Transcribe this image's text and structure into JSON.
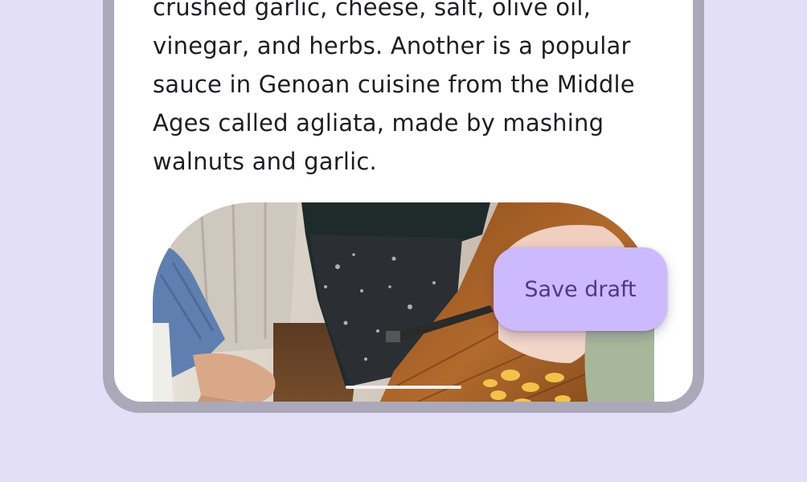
{
  "article": {
    "text_lines": [
      "crushed garlic, cheese, salt, olive oil,",
      "vinegar, and herbs. Another is a popular",
      "sauce in Genoan cuisine from the Middle",
      "Ages called agliata, made by mashing",
      "walnuts and garlic."
    ]
  },
  "hero_image": {
    "description_icon": "photo-cooking-icon"
  },
  "fab": {
    "label": "Save draft"
  },
  "colors": {
    "background": "#e3dff8",
    "frame": "#aba9b9",
    "fab": "#cdb9fd",
    "fab_text": "#4a3a86"
  }
}
